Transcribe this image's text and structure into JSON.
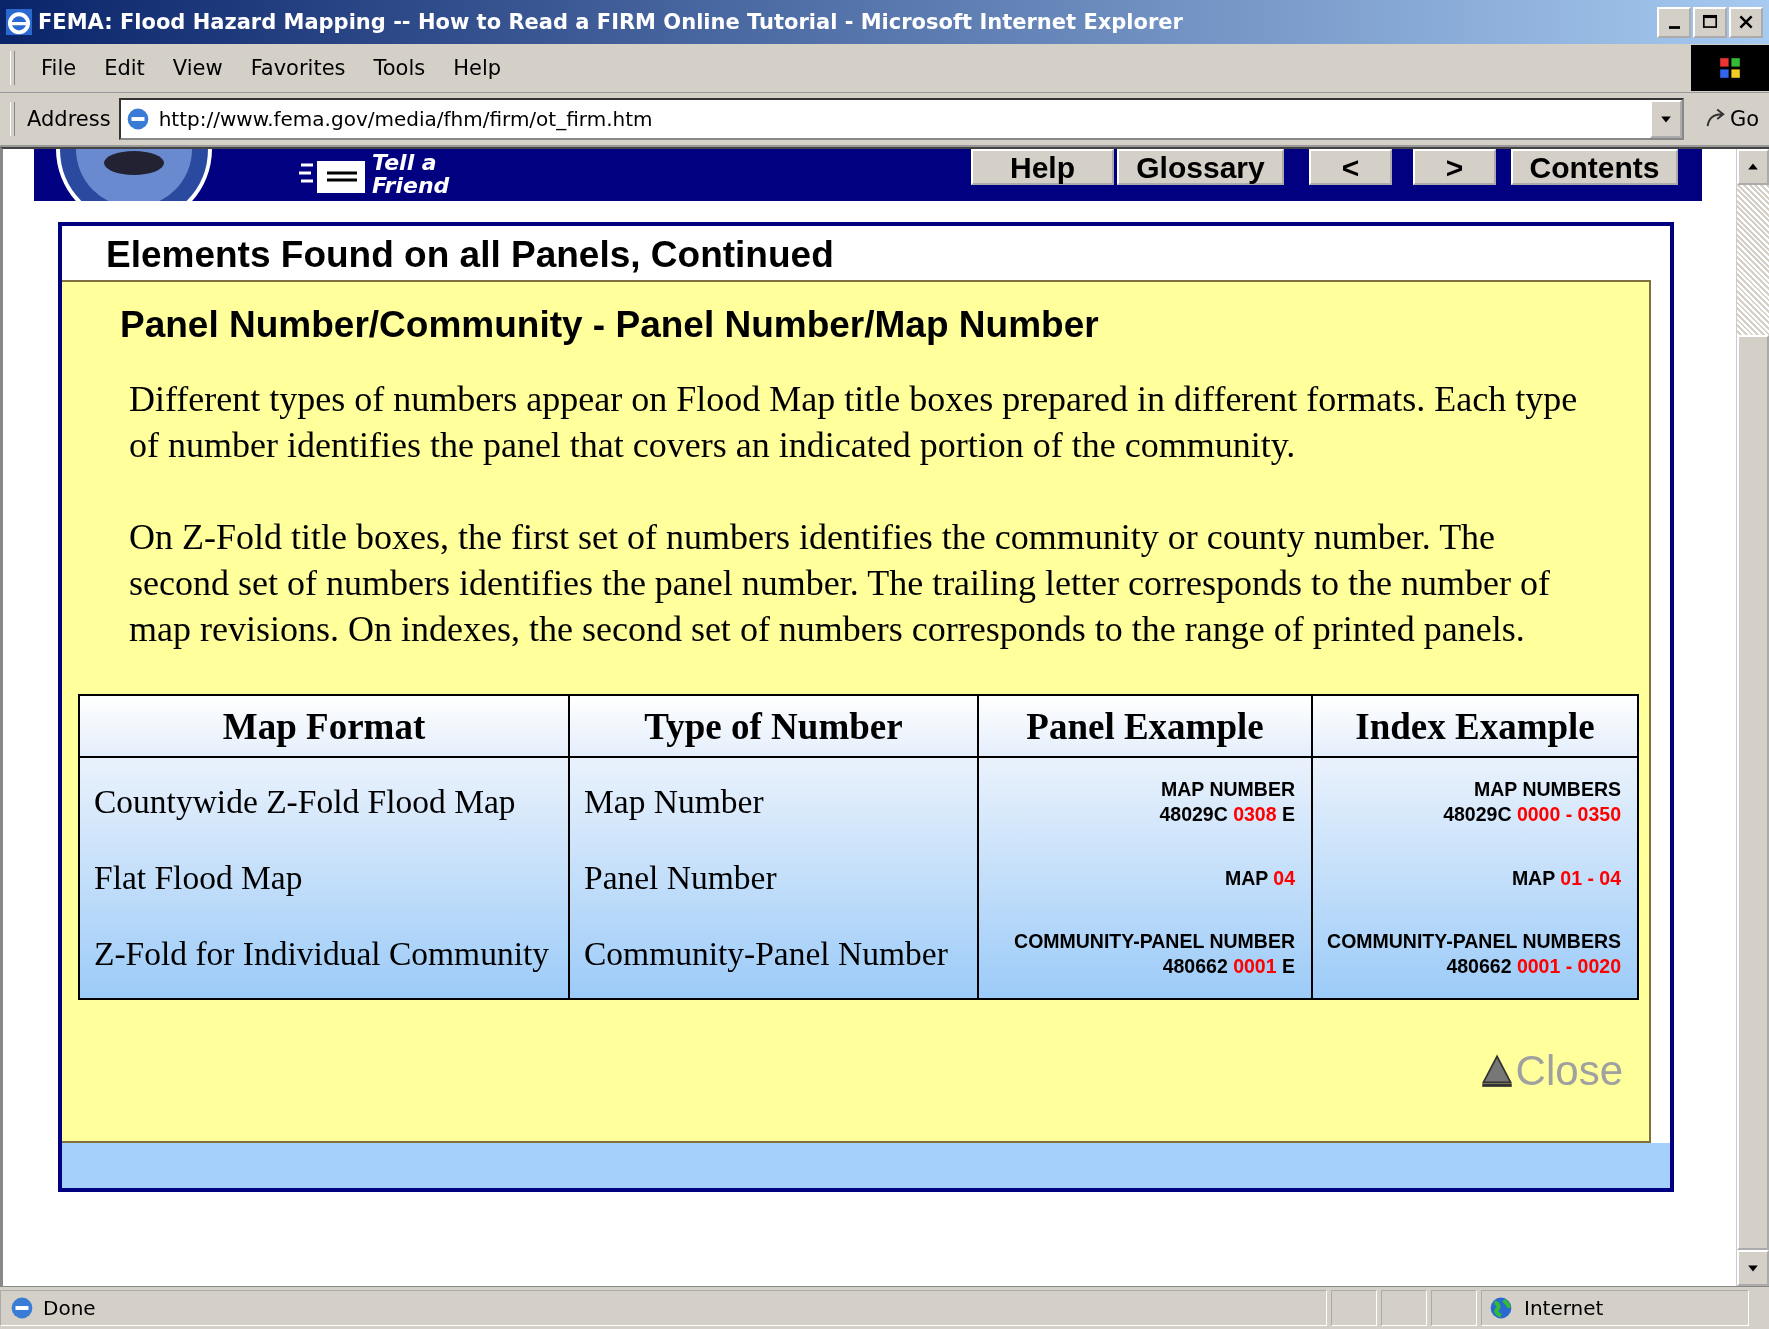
{
  "window": {
    "title": "FEMA: Flood Hazard Mapping -- How to Read a FIRM Online Tutorial - Microsoft Internet Explorer"
  },
  "menu": [
    {
      "label": "File"
    },
    {
      "label": "Edit"
    },
    {
      "label": "View"
    },
    {
      "label": "Favorites"
    },
    {
      "label": "Tools"
    },
    {
      "label": "Help"
    }
  ],
  "address_bar": {
    "label": "Address",
    "url": "http://www.fema.gov/media/fhm/firm/ot_firm.htm",
    "go": "Go"
  },
  "site_header": {
    "tell_a_friend": "Tell a Friend",
    "nav_buttons": [
      {
        "label": "Help"
      },
      {
        "label": "Glossary"
      },
      {
        "label": "<"
      },
      {
        "label": ">"
      },
      {
        "label": "Contents"
      }
    ]
  },
  "section_heading": "Elements Found on all Panels, Continued",
  "popup": {
    "heading": "Panel Number/Community - Panel Number/Map Number",
    "paragraphs": [
      "Different types of numbers appear on Flood Map title boxes prepared in different formats. Each type of number identifies the panel that covers an indicated portion of the community.",
      "On Z-Fold title boxes, the first set of numbers identifies the community or county number. The second set of numbers identifies the panel number. The trailing letter corresponds to the number of map revisions. On indexes, the second set of numbers corresponds to the range of printed panels."
    ],
    "table": {
      "columns": [
        "Map Format",
        "Type of Number",
        "Panel Example",
        "Index Example"
      ],
      "rows": [
        {
          "map_format": "Countywide Z-Fold Flood Map",
          "type_of_number": "Map Number",
          "panel_example": {
            "caption": "MAP NUMBER",
            "parts": [
              {
                "text": "48029C ",
                "highlight": false
              },
              {
                "text": "0308",
                "highlight": true
              },
              {
                "text": " E",
                "highlight": false
              }
            ]
          },
          "index_example": {
            "caption": "MAP NUMBERS",
            "parts": [
              {
                "text": "48029C ",
                "highlight": false
              },
              {
                "text": "0000 - 0350",
                "highlight": true
              }
            ]
          }
        },
        {
          "map_format": "Flat Flood Map",
          "type_of_number": "Panel Number",
          "panel_example": {
            "parts": [
              {
                "text": "MAP ",
                "highlight": false
              },
              {
                "text": "04",
                "highlight": true
              }
            ]
          },
          "index_example": {
            "parts": [
              {
                "text": "MAP ",
                "highlight": false
              },
              {
                "text": "01 - 04",
                "highlight": true
              }
            ]
          }
        },
        {
          "map_format": "Z-Fold  for Individual Community",
          "type_of_number": "Community-Panel Number",
          "panel_example": {
            "caption": "COMMUNITY-PANEL NUMBER",
            "parts": [
              {
                "text": "480662 ",
                "highlight": false
              },
              {
                "text": "0001",
                "highlight": true
              },
              {
                "text": " E",
                "highlight": false
              }
            ]
          },
          "index_example": {
            "caption": "COMMUNITY-PANEL NUMBERS",
            "parts": [
              {
                "text": "480662 ",
                "highlight": false
              },
              {
                "text": "0001 - 0020",
                "highlight": true
              }
            ]
          }
        }
      ]
    },
    "close": {
      "label": "Close",
      "disabled": true
    }
  },
  "status_bar": {
    "text": "Done",
    "zone": "Internet"
  }
}
